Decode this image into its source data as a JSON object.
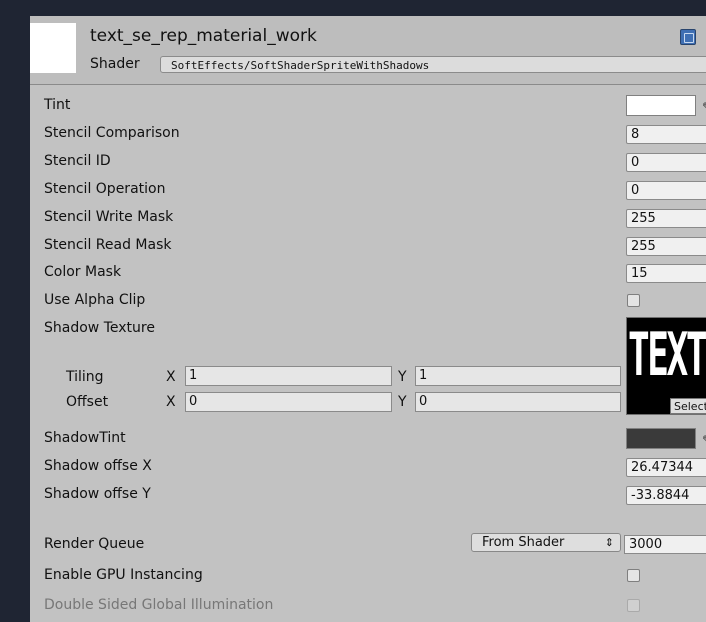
{
  "header": {
    "material_name": "text_se_rep_material_work",
    "shader_label": "Shader",
    "shader_value": "SoftEffects/SoftShaderSpriteWithShadows"
  },
  "properties": {
    "tint_label": "Tint",
    "tint_color": "#ffffff",
    "stencil_comparison": {
      "label": "Stencil Comparison",
      "value": "8"
    },
    "stencil_id": {
      "label": "Stencil ID",
      "value": "0"
    },
    "stencil_operation": {
      "label": "Stencil Operation",
      "value": "0"
    },
    "stencil_write_mask": {
      "label": "Stencil Write Mask",
      "value": "255"
    },
    "stencil_read_mask": {
      "label": "Stencil Read Mask",
      "value": "255"
    },
    "color_mask": {
      "label": "Color Mask",
      "value": "15"
    },
    "use_alpha_clip": {
      "label": "Use Alpha Clip",
      "checked": false
    },
    "shadow_texture": {
      "label": "Shadow Texture",
      "preview_text": "TEXT",
      "select_label": "Select",
      "tiling_label": "Tiling",
      "offset_label": "Offset",
      "x_axis": "X",
      "y_axis": "Y",
      "tiling_x": "1",
      "tiling_y": "1",
      "offset_x": "0",
      "offset_y": "0"
    },
    "shadow_tint_label": "ShadowTint",
    "shadow_tint_color": "#3a3a3a",
    "shadow_offset_x": {
      "label": "Shadow offse X",
      "value": "26.47344"
    },
    "shadow_offset_y": {
      "label": "Shadow offse Y",
      "value": "-33.8844"
    }
  },
  "render": {
    "render_queue_label": "Render Queue",
    "render_queue_mode": "From Shader",
    "render_queue_value": "3000",
    "gpu_instancing_label": "Enable GPU Instancing",
    "gpu_instancing_checked": false,
    "double_sided_gi_label": "Double Sided Global Illumination",
    "double_sided_gi_checked": false
  },
  "colors": {
    "background": "#1f2533",
    "panel": "#c2c2c2",
    "header": "#bdbdbd"
  }
}
